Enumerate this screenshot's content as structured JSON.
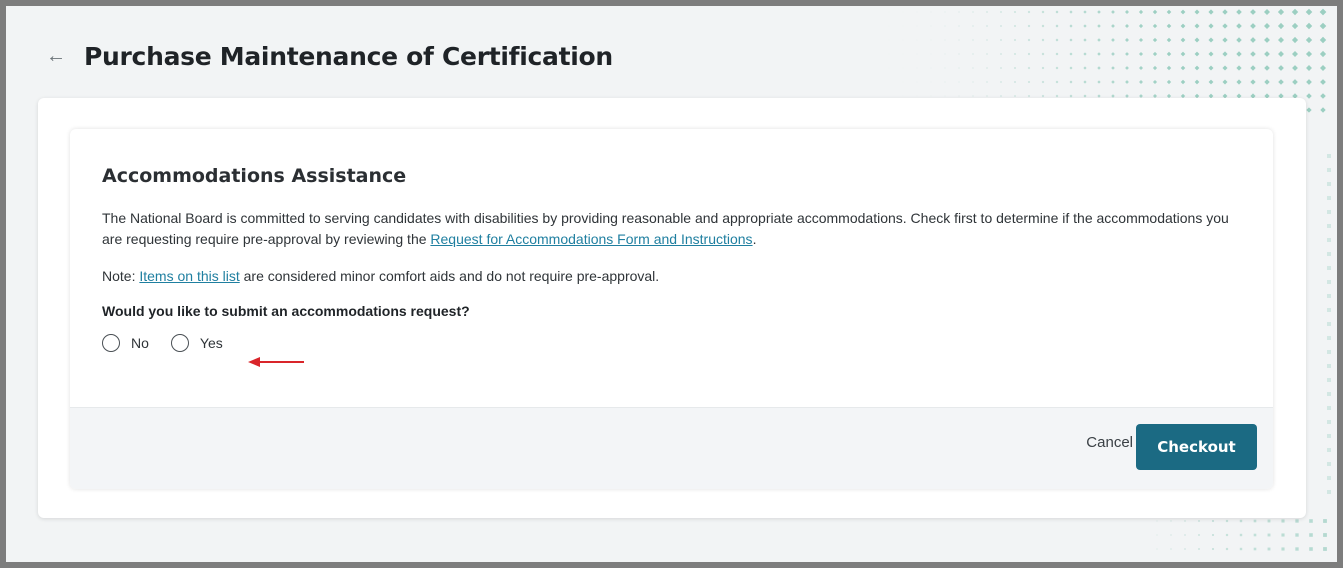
{
  "header": {
    "back_icon": "arrow-left-icon",
    "title": "Purchase Maintenance of Certification"
  },
  "section": {
    "title": "Accommodations Assistance",
    "paragraph_text": "The National Board is committed to serving candidates with disabilities by providing reasonable and appropriate accommodations. Check first to determine if the accommodations you are requesting require pre-approval by reviewing the ",
    "paragraph_link": "Request for Accommodations Form and Instructions",
    "paragraph_end": ".",
    "note_prefix": "Note: ",
    "note_link": "Items on this list",
    "note_suffix": " are considered minor comfort aids and do not require pre-approval.",
    "question": "Would you like to submit an accommodations request?",
    "options": [
      {
        "label": "No",
        "selected": false
      },
      {
        "label": "Yes",
        "selected": false
      }
    ]
  },
  "footer": {
    "cancel_label": "Cancel",
    "checkout_label": "Checkout"
  },
  "colors": {
    "accent": "#1b6a83",
    "link": "#1f7fa0",
    "annotation_arrow": "#d9252a",
    "dots": "#9ccfc2"
  }
}
